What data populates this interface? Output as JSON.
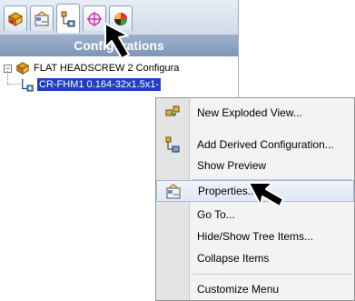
{
  "panel": {
    "title": "Configurations",
    "tabs": [
      {
        "icon": "featuremanager-tree-icon"
      },
      {
        "icon": "propertymanager-icon"
      },
      {
        "icon": "configurationmanager-icon",
        "active": true
      },
      {
        "icon": "dimxpert-icon"
      },
      {
        "icon": "display-manager-icon"
      }
    ],
    "tree": {
      "root": {
        "expander": "−",
        "label": "FLAT HEADSCREW 2 Configura",
        "icon": "configuration-folder-icon"
      },
      "child": {
        "label": "CR-FHM1 0.164-32x1.5x1-",
        "icon": "configuration-icon"
      }
    }
  },
  "menu": {
    "items": [
      {
        "label": "New Exploded View...",
        "icon": "exploded-view-icon"
      },
      {
        "label": "Add Derived Configuration...",
        "icon": "derived-config-icon"
      },
      {
        "label": "Show Preview",
        "icon": ""
      },
      {
        "label": "Properties...",
        "icon": "properties-icon",
        "hover": true
      },
      {
        "label": "Go To...",
        "icon": ""
      },
      {
        "label": "Hide/Show Tree Items...",
        "icon": ""
      },
      {
        "label": "Collapse Items",
        "icon": ""
      },
      {
        "label": "Customize Menu",
        "icon": ""
      }
    ]
  },
  "colors": {
    "selection": "#1f3fbf",
    "title_bar": "#8aa0bf",
    "pointer": "#000000"
  }
}
